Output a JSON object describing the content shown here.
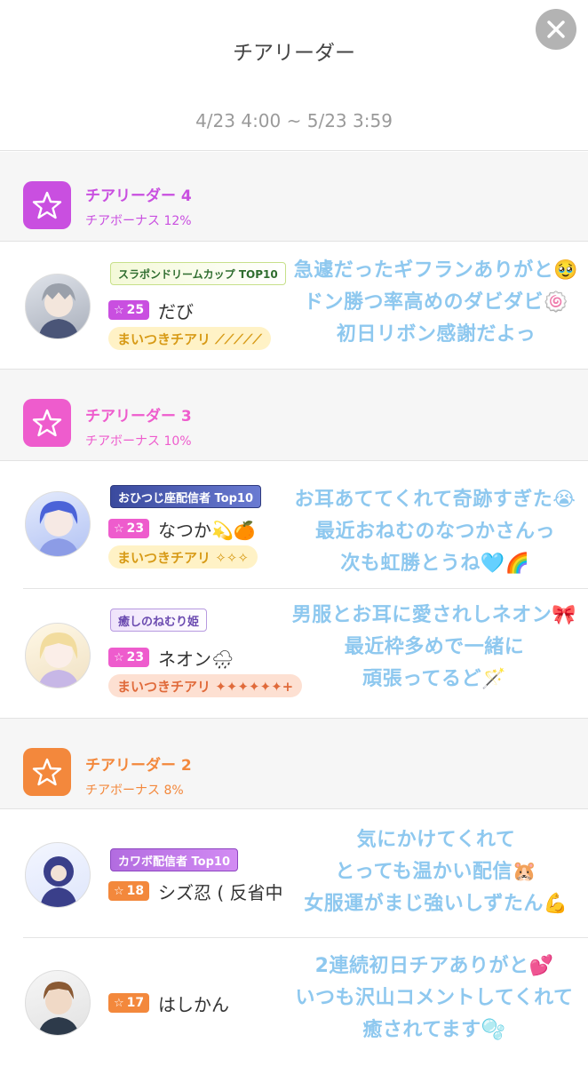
{
  "header": {
    "title": "チアリーダー",
    "period": "4/23 4:00 ~ 5/23 3:59"
  },
  "colors": {
    "tier4": "#c94fe0",
    "tier3": "#ee5ccd",
    "tier2": "#f3883c",
    "message": "#8ec8ef"
  },
  "sections": [
    {
      "name": "チアリーダー 4",
      "bonus": "チアボーナス 12%",
      "icon": "star-icon",
      "users": [
        {
          "badge": "スラポンドリームカップ TOP10",
          "level": "25",
          "name": "だび",
          "tag": "まいつきチアリ ⟋⟋⟋⟋⟋",
          "message": [
            "急遽だったギフランありがと🥹",
            "ドン勝つ率高めのダビダビ🍥",
            "初日リボン感謝だよっ"
          ]
        }
      ]
    },
    {
      "name": "チアリーダー 3",
      "bonus": "チアボーナス 10%",
      "icon": "star-icon",
      "users": [
        {
          "badge": "おひつじ座配信者 Top10",
          "level": "23",
          "name": "なつか💫🍊",
          "tag": "まいつきチアリ ✧✧✧",
          "message": [
            "お耳あててくれて奇跡すぎた😭",
            "最近おねむのなつかさんっ",
            "次も虹勝とうね🩵🌈"
          ]
        },
        {
          "badge": "癒しのねむり姫",
          "level": "23",
          "name": "ネオン🌧",
          "tag": "まいつきチアリ ✦✦✦✦✦✦+",
          "message": [
            "男服とお耳に愛されしネオン🎀",
            "最近枠多めで一緒に",
            "頑張ってるど🪄"
          ]
        }
      ]
    },
    {
      "name": "チアリーダー 2",
      "bonus": "チアボーナス 8%",
      "icon": "star-icon",
      "users": [
        {
          "badge": "カワボ配信者 Top10",
          "level": "18",
          "name": "シズ忍 ( 反省中",
          "message": [
            "気にかけてくれて",
            "とっても温かい配信🐹",
            "女服運がまじ強いしずたん💪"
          ]
        },
        {
          "level": "17",
          "name": "はしかん",
          "message": [
            "2連続初日チアありがと💕",
            "いつも沢山コメントしてくれて",
            "癒されてます🫧"
          ]
        }
      ]
    }
  ]
}
